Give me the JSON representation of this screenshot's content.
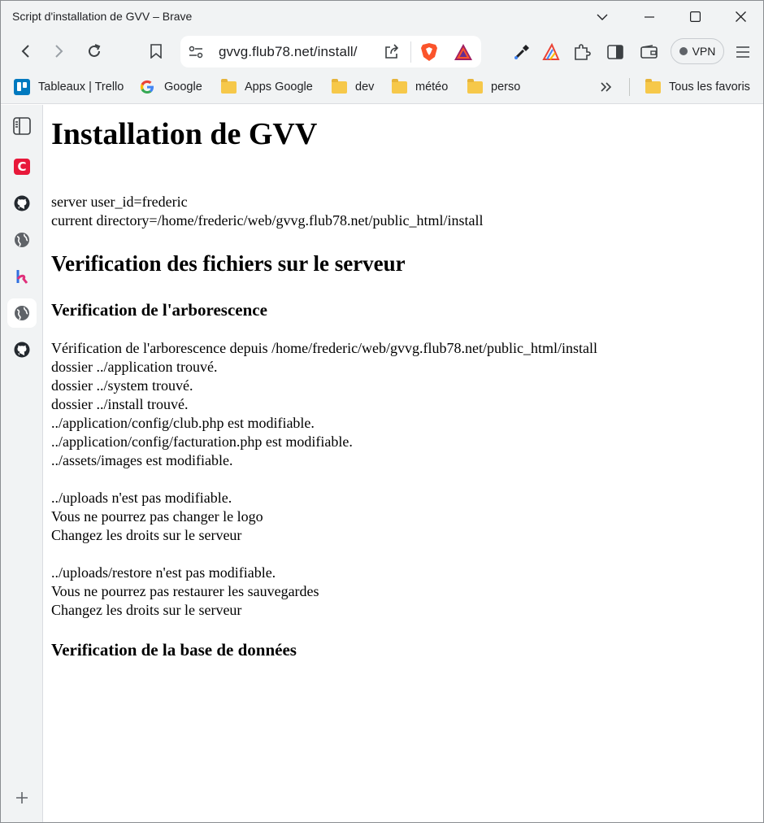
{
  "window": {
    "title": "Script d'installation de GVV – Brave"
  },
  "toolbar": {
    "url": "gvvg.flub78.net/install/",
    "vpn_label": "VPN"
  },
  "bookmarks": [
    {
      "label": "Tableaux | Trello",
      "icon": "trello-icon"
    },
    {
      "label": "Google",
      "icon": "google-icon"
    },
    {
      "label": "Apps Google",
      "icon": "folder-icon"
    },
    {
      "label": "dev",
      "icon": "folder-icon"
    },
    {
      "label": "météo",
      "icon": "folder-icon"
    },
    {
      "label": "perso",
      "icon": "folder-icon"
    },
    {
      "label": "Tous les favoris",
      "icon": "folder-icon"
    }
  ],
  "page": {
    "title": "Installation de GVV",
    "server_user": "server user_id=frederic",
    "current_dir": "current directory=/home/frederic/web/gvvg.flub78.net/public_html/install",
    "section1": "Verification des fichiers sur le serveur",
    "subsection1": "Verification de l'arborescence",
    "lines": [
      "Vérification de l'arborescence depuis /home/frederic/web/gvvg.flub78.net/public_html/install",
      "dossier ../application trouvé.",
      "dossier ../system trouvé.",
      "dossier ../install trouvé.",
      "../application/config/club.php est modifiable.",
      "../application/config/facturation.php est modifiable.",
      "../assets/images est modifiable.",
      "../uploads n'est pas modifiable.",
      "Vous ne pourrez pas changer le logo",
      "Changez les droits sur le serveur",
      "../uploads/restore n'est pas modifiable.",
      "Vous ne pourrez pas restaurer les sauvegardes",
      "Changez les droits sur le serveur"
    ],
    "subsection2": "Verification de la base de données"
  },
  "colors": {
    "chrome": "#f1f3f4",
    "brave_orange": "#fb542b",
    "trello_blue": "#0079bf",
    "folder_yellow": "#f6c84a"
  }
}
